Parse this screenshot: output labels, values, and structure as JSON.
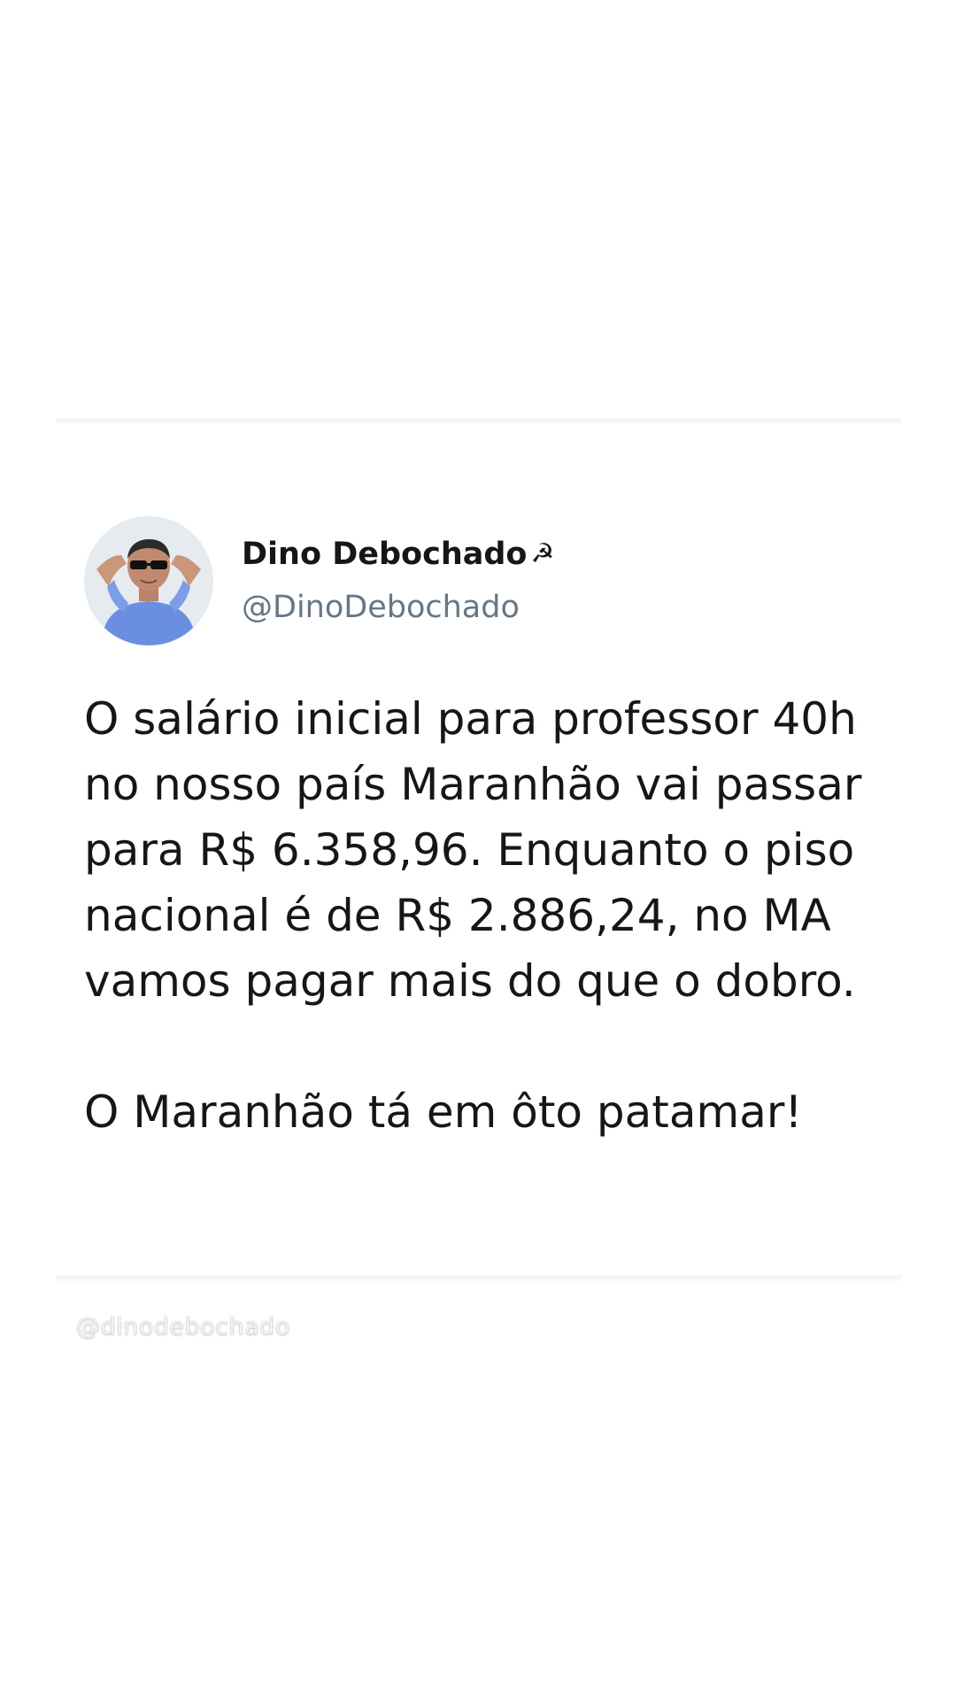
{
  "tweet": {
    "author": {
      "display_name": "Dino Debochado",
      "name_emoji": "☭",
      "handle": "@DinoDebochado",
      "avatar_icon": "avatar-photo"
    },
    "paragraphs": [
      "O salário inicial para professor 40h no nosso país Maranhão vai passar para R$ 6.358,96. Enquanto o piso nacional é de R$ 2.886,24, no MA vamos pagar mais do que o dobro.",
      "O Maranhão tá em ôto patamar!"
    ]
  },
  "watermark": "@dinodebochado",
  "colors": {
    "text": "#14171a",
    "handle": "#657786",
    "background": "#ffffff"
  }
}
